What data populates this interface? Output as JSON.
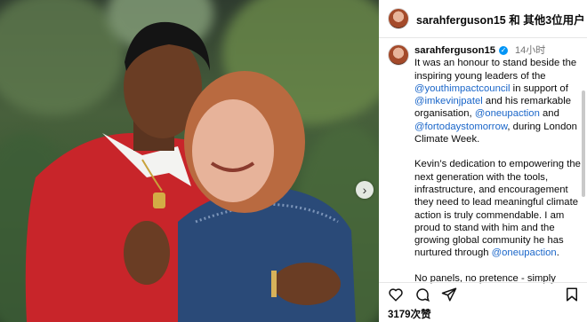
{
  "header": {
    "username": "sarahferguson15",
    "suffix": "和 其他3位用户"
  },
  "caption": {
    "username": "sarahferguson15",
    "time": "14小时",
    "p1_a": "It was an honour to stand beside the inspiring young leaders of the ",
    "p1_l1": "@youthimpactcouncil",
    "p1_b": " in support of ",
    "p1_l2": "@imkevinjpatel",
    "p1_c": " and his remarkable organisation, ",
    "p1_l3": "@oneupaction",
    "p1_d": " and ",
    "p1_l4": "@fortodaystomorrow",
    "p1_e": ", during London Climate Week.",
    "p2_a": "Kevin’s dedication to empowering the next generation with the tools, infrastructure, and encouragement they need to lead meaningful climate action is truly commendable. I am proud to stand with him and the growing global community he has nurtured through ",
    "p2_l1": "@oneupaction",
    "p2_b": ".",
    "p3": "No panels, no pretence - simply purpose, unity, and courageous action for our planet. 🌍 ❤️"
  },
  "likes": "3179次赞",
  "icons": [
    "heart-icon",
    "comment-icon",
    "share-icon",
    "bookmark-icon",
    "verified-icon",
    "chevron-right-icon"
  ]
}
